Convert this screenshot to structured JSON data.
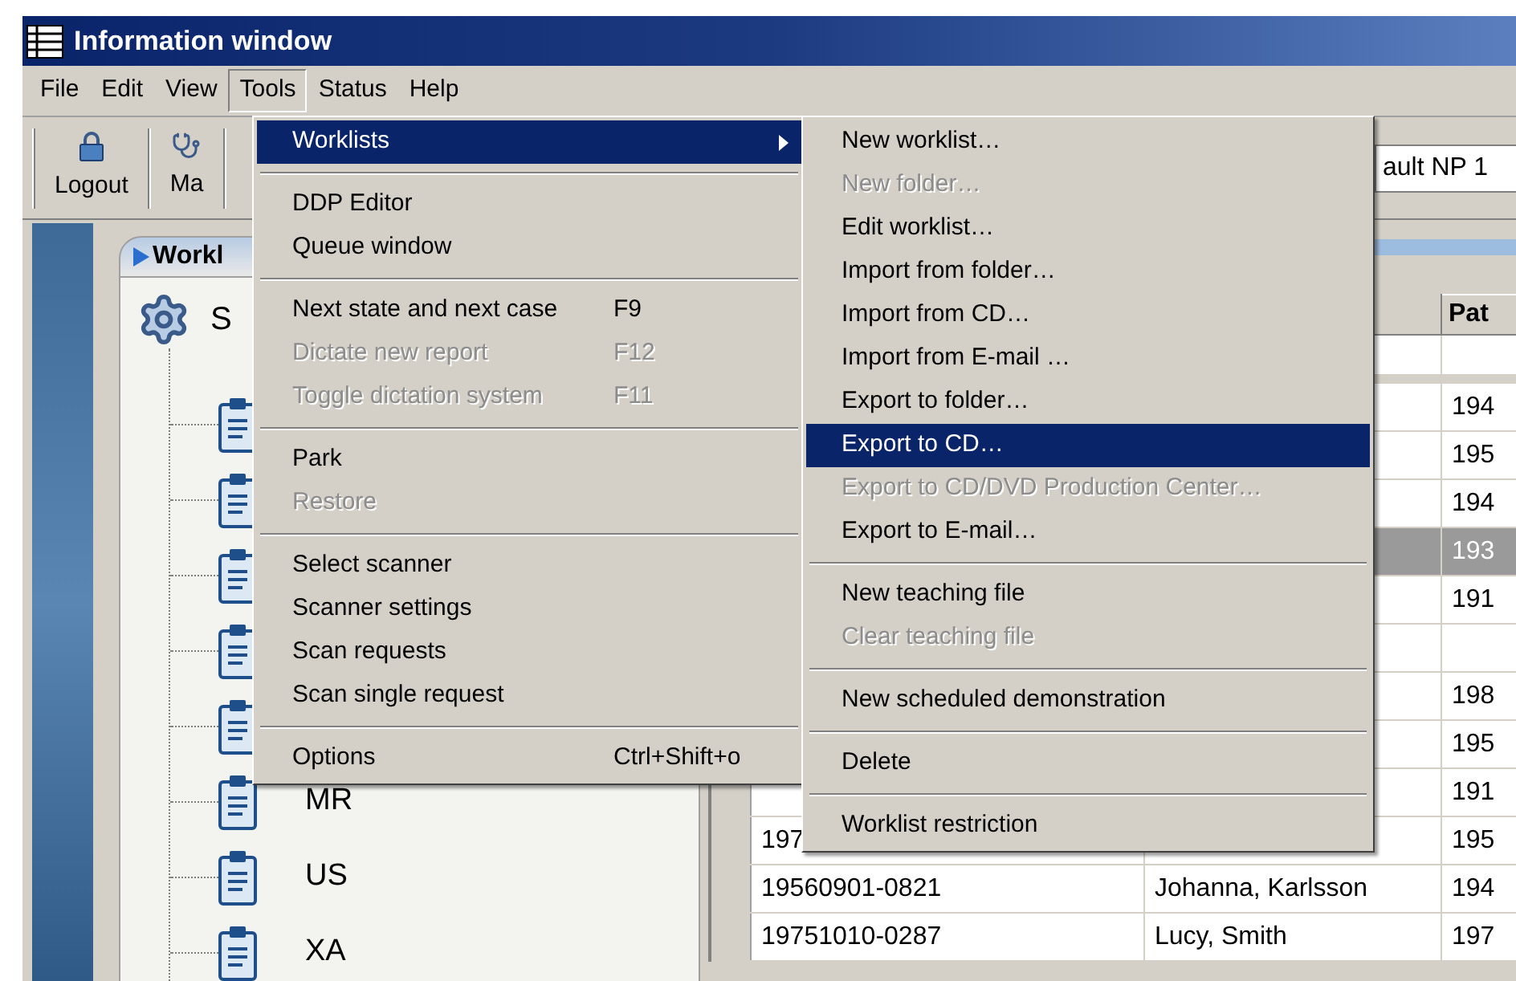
{
  "window": {
    "title": "Information window"
  },
  "menu_bar": [
    {
      "label": "File",
      "selected": false
    },
    {
      "label": "Edit",
      "selected": false
    },
    {
      "label": "View",
      "selected": false
    },
    {
      "label": "Tools",
      "selected": true
    },
    {
      "label": "Status",
      "selected": false
    },
    {
      "label": "Help",
      "selected": false
    }
  ],
  "toolbar": {
    "buttons": [
      {
        "label": "Logout"
      },
      {
        "label": "Ma"
      }
    ],
    "field": {
      "value": "ault NP 1"
    }
  },
  "worklist_panel": {
    "tab": "Workl",
    "tree": {
      "label": "S",
      "children": [
        {
          "kind": "clipboard"
        },
        {
          "kind": "clipboard"
        },
        {
          "kind": "clipboard"
        },
        {
          "kind": "clipboard"
        },
        {
          "kind": "clipboard"
        },
        {
          "kind": "clipboard",
          "label": "MR"
        },
        {
          "kind": "clipboard",
          "label": "US"
        },
        {
          "kind": "clipboard",
          "label": "XA"
        }
      ]
    }
  },
  "table": {
    "column_3_header": "Pat",
    "rows": [
      {
        "column_3": "194",
        "selected": false
      },
      {
        "column_3": "195",
        "selected": false
      },
      {
        "column_3": "194",
        "selected": false
      },
      {
        "column_3": "193",
        "selected": true
      },
      {
        "column_3": "191",
        "selected": false
      },
      {
        "selected": false
      },
      {
        "column_3": "198",
        "selected": false
      },
      {
        "column_3": "195",
        "selected": false
      },
      {
        "column_3": "191",
        "selected": false
      },
      {
        "column_1": "197",
        "column_3": "195",
        "selected": false
      },
      {
        "column_1": "19560901-0821",
        "column_2": "Johanna, Karlsson",
        "column_3": "194",
        "selected": false
      },
      {
        "column_1": "19751010-0287",
        "column_2": "Lucy, Smith",
        "column_3": "197",
        "selected": false
      }
    ]
  },
  "tools_menu": [
    {
      "kind": "item",
      "label": "Worklists",
      "selected": true,
      "disabled": false,
      "has_submenu": true
    },
    {
      "kind": "separator"
    },
    {
      "kind": "item",
      "label": "DDP Editor",
      "selected": false,
      "disabled": false
    },
    {
      "kind": "item",
      "label": "Queue window",
      "selected": false,
      "disabled": false
    },
    {
      "kind": "separator"
    },
    {
      "kind": "item",
      "label": "Next state and next case",
      "shortcut": "F9",
      "selected": false,
      "disabled": false
    },
    {
      "kind": "item",
      "label": "Dictate new report",
      "shortcut": "F12",
      "selected": false,
      "disabled": true
    },
    {
      "kind": "item",
      "label": "Toggle dictation system",
      "shortcut": "F11",
      "selected": false,
      "disabled": true
    },
    {
      "kind": "separator"
    },
    {
      "kind": "item",
      "label": "Park",
      "selected": false,
      "disabled": false
    },
    {
      "kind": "item",
      "label": "Restore",
      "selected": false,
      "disabled": true
    },
    {
      "kind": "separator"
    },
    {
      "kind": "item",
      "label": "Select scanner",
      "selected": false,
      "disabled": false
    },
    {
      "kind": "item",
      "label": "Scanner settings",
      "selected": false,
      "disabled": false
    },
    {
      "kind": "item",
      "label": "Scan requests",
      "selected": false,
      "disabled": false
    },
    {
      "kind": "item",
      "label": "Scan single request",
      "selected": false,
      "disabled": false
    },
    {
      "kind": "separator"
    },
    {
      "kind": "item",
      "label": "Options",
      "shortcut": "Ctrl+Shift+o",
      "selected": false,
      "disabled": false
    }
  ],
  "worklists_submenu": [
    {
      "kind": "item",
      "label": "New worklist…",
      "selected": false,
      "disabled": false
    },
    {
      "kind": "item",
      "label": "New folder…",
      "selected": false,
      "disabled": true
    },
    {
      "kind": "item",
      "label": "Edit worklist…",
      "selected": false,
      "disabled": false
    },
    {
      "kind": "item",
      "label": "Import from folder…",
      "selected": false,
      "disabled": false
    },
    {
      "kind": "item",
      "label": "Import from CD…",
      "selected": false,
      "disabled": false
    },
    {
      "kind": "item",
      "label": "Import from E-mail …",
      "selected": false,
      "disabled": false
    },
    {
      "kind": "item",
      "label": "Export to folder…",
      "selected": false,
      "disabled": false
    },
    {
      "kind": "item",
      "label": "Export to CD…",
      "selected": true,
      "disabled": false
    },
    {
      "kind": "item",
      "label": "Export to CD/DVD Production Center…",
      "selected": false,
      "disabled": true
    },
    {
      "kind": "item",
      "label": "Export to E-mail…",
      "selected": false,
      "disabled": false
    },
    {
      "kind": "separator"
    },
    {
      "kind": "item",
      "label": "New teaching file",
      "selected": false,
      "disabled": false
    },
    {
      "kind": "item",
      "label": "Clear teaching file",
      "selected": false,
      "disabled": true
    },
    {
      "kind": "separator"
    },
    {
      "kind": "item",
      "label": "New scheduled demonstration",
      "selected": false,
      "disabled": false
    },
    {
      "kind": "separator"
    },
    {
      "kind": "item",
      "label": "Delete",
      "selected": false,
      "disabled": false
    },
    {
      "kind": "separator"
    },
    {
      "kind": "item",
      "label": "Worklist restriction",
      "selected": false,
      "disabled": false
    }
  ]
}
